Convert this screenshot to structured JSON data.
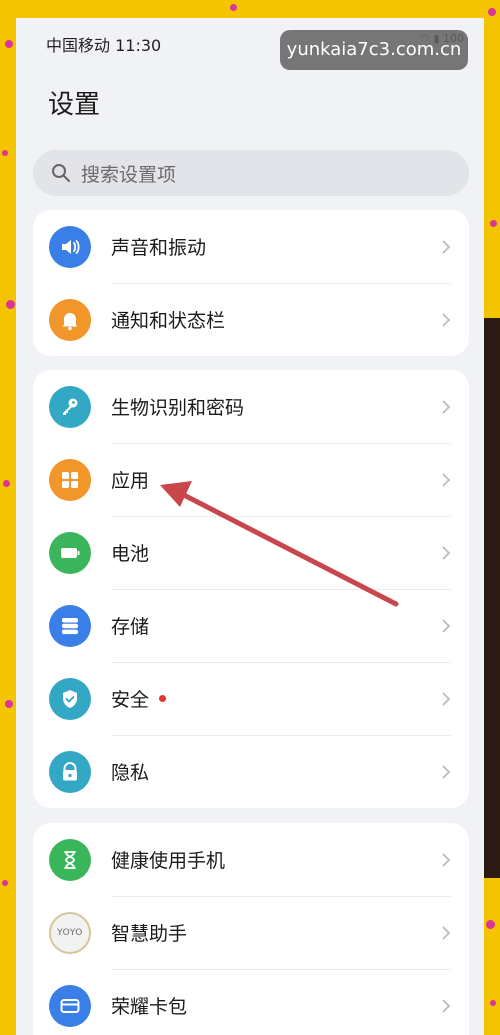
{
  "status_bar": {
    "carrier_time": "中国移动 11:30",
    "battery": "100"
  },
  "watermark": "yunkaia7c3.com.cn",
  "header": {
    "title": "设置"
  },
  "search": {
    "placeholder": "搜索设置项"
  },
  "groups": [
    {
      "items": [
        {
          "label": "声音和振动",
          "icon": "speaker-icon",
          "color": "#3a7ee8"
        },
        {
          "label": "通知和状态栏",
          "icon": "bell-icon",
          "color": "#f0962a"
        }
      ]
    },
    {
      "items": [
        {
          "label": "生物识别和密码",
          "icon": "key-icon",
          "color": "#33a8c4"
        },
        {
          "label": "应用",
          "icon": "apps-grid-icon",
          "color": "#f0962a"
        },
        {
          "label": "电池",
          "icon": "battery-icon",
          "color": "#3ab55c"
        },
        {
          "label": "存储",
          "icon": "storage-icon",
          "color": "#3a7ee8"
        },
        {
          "label": "安全",
          "icon": "shield-icon",
          "color": "#33a8c4",
          "badge": true
        },
        {
          "label": "隐私",
          "icon": "privacy-lock-icon",
          "color": "#33a8c4"
        }
      ]
    },
    {
      "items": [
        {
          "label": "健康使用手机",
          "icon": "hourglass-icon",
          "color": "#3ab55c"
        },
        {
          "label": "智慧助手",
          "icon": "yoyo-icon",
          "color": "#e8e8e8",
          "icon_text": "YOYO"
        },
        {
          "label": "荣耀卡包",
          "icon": "wallet-icon",
          "color": "#3a7ee8"
        }
      ]
    }
  ]
}
